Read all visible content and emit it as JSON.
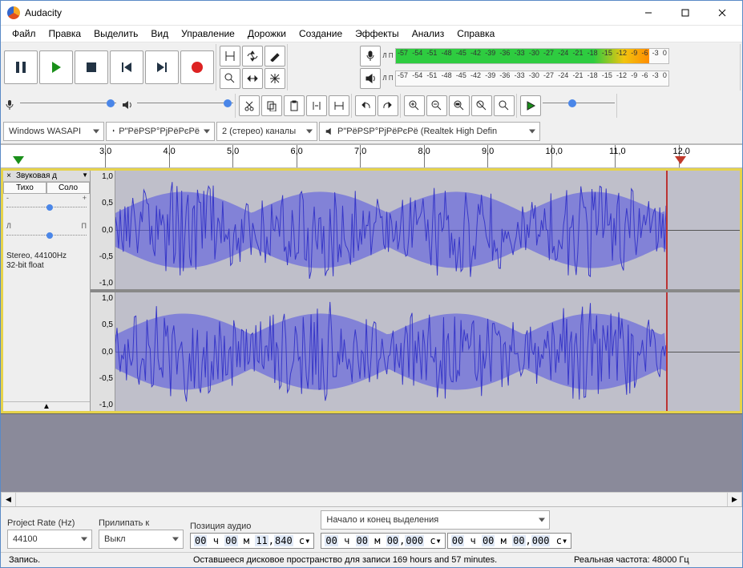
{
  "title": "Audacity",
  "menu": [
    "Файл",
    "Правка",
    "Выделить",
    "Вид",
    "Управление",
    "Дорожки",
    "Создание",
    "Эффекты",
    "Анализ",
    "Справка"
  ],
  "transport": {
    "pause": "pause-icon",
    "play": "play-icon",
    "stop": "stop-icon",
    "skip_start": "skip-start-icon",
    "skip_end": "skip-end-icon",
    "record": "record-icon"
  },
  "tools": {
    "row1": [
      "selection-tool-icon",
      "envelope-tool-icon",
      "draw-tool-icon"
    ],
    "row2": [
      "zoom-tool-icon",
      "timeshift-tool-icon",
      "multi-tool-icon"
    ]
  },
  "meters": {
    "rec_label": "Л П",
    "play_label": "Л П",
    "ticks": [
      "-57",
      "-54",
      "-51",
      "-48",
      "-45",
      "-42",
      "-39",
      "-36",
      "-33",
      "-30",
      "-27",
      "-24",
      "-21",
      "-18",
      "-15",
      "-12",
      "-9",
      "-6",
      "-3",
      "0"
    ]
  },
  "mixer": {
    "rec_pos_pct": 90,
    "play_pos_pct": 90
  },
  "edit_buttons": [
    "cut-icon",
    "copy-icon",
    "paste-icon",
    "trim-icon",
    "silence-icon"
  ],
  "history_buttons": [
    "undo-icon",
    "redo-icon"
  ],
  "zoom_buttons": [
    "zoom-in-icon",
    "zoom-out-icon",
    "zoom-sel-icon",
    "zoom-fit-icon",
    "zoom-toggle-icon"
  ],
  "play_at_speed": {
    "btn": "play-speed-icon",
    "slider_pct": 35
  },
  "devices": {
    "host": "Windows WASAPI",
    "rec_dev": "Р\"РёРЅР°РјРёРєРё",
    "channels": "2 (стерео) каналы",
    "play_dev": "Р\"РёРЅР°РјРёРєРё (Realtek High Defin"
  },
  "ruler": {
    "labels": [
      "3,0",
      "4,0",
      "5,0",
      "6,0",
      "7,0",
      "8,0",
      "9,0",
      "10,0",
      "11,0",
      "12,0"
    ]
  },
  "track": {
    "name": "Звуковая д",
    "mute": "Тихо",
    "solo": "Соло",
    "gain_labels": [
      "-",
      "+"
    ],
    "gain_pos_pct": 50,
    "pan_labels": [
      "Л",
      "П"
    ],
    "pan_pos_pct": 50,
    "info1": "Stereo, 44100Hz",
    "info2": "32-bit float",
    "vaxis": [
      "1,0",
      "0,5",
      "0,0",
      "-0,5",
      "-1,0"
    ]
  },
  "footer": {
    "project_rate_label": "Project Rate (Hz)",
    "project_rate": "44100",
    "snap_label": "Прилипать к",
    "snap": "Выкл",
    "pos_label": "Позиция аудио",
    "pos_value": {
      "h": "00",
      "m": "00",
      "s": "11",
      "ms": "840",
      "h_lbl": "ч",
      "m_lbl": "м",
      "s_lbl": "с"
    },
    "sel_label": "Начало и конец выделения",
    "sel_start": {
      "h": "00",
      "m": "00",
      "s": "00",
      "ms": "000"
    },
    "sel_end": {
      "h": "00",
      "m": "00",
      "s": "00",
      "ms": "000"
    },
    "status": "Запись.",
    "disk": "Оставшееся дисковое пространство для записи 169 hours and 57 minutes.",
    "actual": "Реальная частота: 48000 Гц"
  }
}
